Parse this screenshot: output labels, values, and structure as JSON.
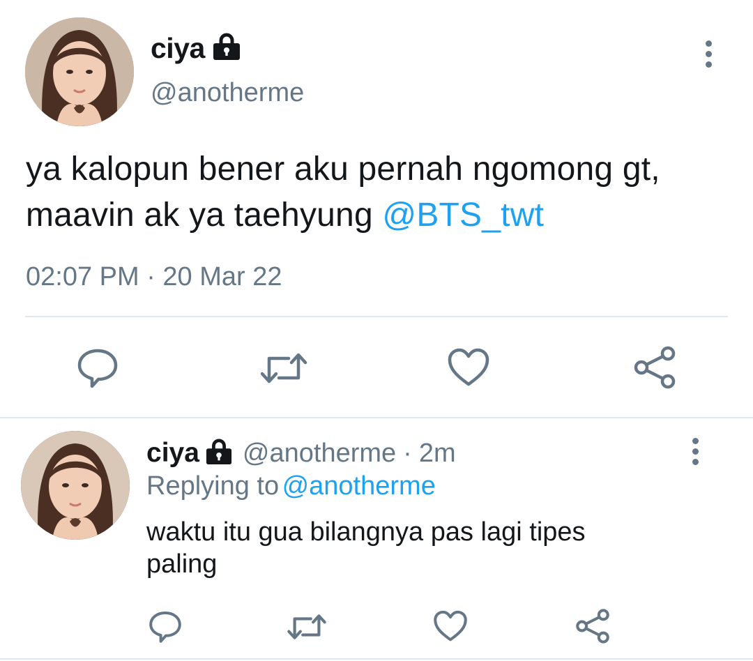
{
  "main_tweet": {
    "display_name": "ciya",
    "handle": "@anotherme",
    "text": "ya kalopun bener aku pernah ngomong gt,",
    "text_line2": "maavin ak ya taehyung",
    "mention": "@BTS_twt",
    "timestamp": "02:07 PM · 20 Mar 22",
    "icons": {
      "lock": "lock-icon",
      "more": "more-vertical-icon",
      "reply": "comment-icon",
      "retweet": "retweet-icon",
      "like": "heart-icon",
      "share": "share-icon"
    }
  },
  "reply_tweet": {
    "display_name": "ciya",
    "handle": "@anotherme",
    "separator": "·",
    "time_ago": "2m",
    "replying_to_label": "Replying to",
    "replying_to_handle": "@anotherme",
    "text_line1": "waktu itu gua bilangnya pas lagi tipes",
    "text_line2": "paling"
  },
  "colors": {
    "text": "#14171a",
    "secondary": "#657786",
    "link": "#1da1f2",
    "divider": "#e1e8ed"
  }
}
